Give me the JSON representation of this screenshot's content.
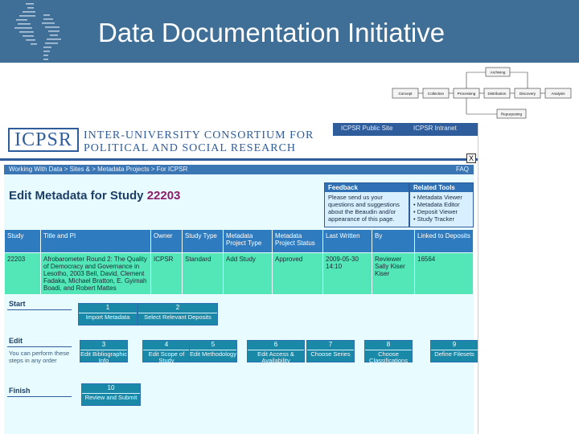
{
  "slide": {
    "title": "Data Documentation Initiative"
  },
  "lifecycle": {
    "stages": [
      "Concept",
      "Collection",
      "Processing",
      "Distribution",
      "Discovery",
      "Analysis"
    ],
    "archiving": "Archiving",
    "repurposing": "Repurposing"
  },
  "icpsr": {
    "logo": "ICPSR",
    "name_line1": "INTER-UNIVERSITY CONSORTIUM FOR",
    "name_line2": "POLITICAL AND SOCIAL RESEARCH",
    "toplinks": [
      "ICPSR Public Site",
      "ICPSR Intranet"
    ],
    "close_label": "X",
    "breadcrumb": "Working With Data > Sites & > Metadata Projects > For ICPSR",
    "breadcrumb_right": "FAQ",
    "heading_prefix": "Edit Metadata for Study",
    "study_number": "22203",
    "feedback": {
      "title": "Feedback",
      "text": "Please send us your questions and suggestions about the Beaudin and/or appearance of this page."
    },
    "related": {
      "title": "Related Tools",
      "items": [
        "• Metadata Viewer",
        "• Metadata Editor",
        "• Deposit Viewer",
        "• Study Tracker"
      ]
    },
    "table": {
      "headers": [
        "Study",
        "Title and PI",
        "Owner",
        "Study Type",
        "Metadata Project Type",
        "Metadata Project Status",
        "Last Written",
        "By",
        "Linked to Deposits"
      ],
      "row": [
        "22203",
        "Afrobarometer Round 2: The Quality of Democracy and Governance in Lesotho, 2003 Bell, David, Clement Fadaka, Michael Bratton, E. Gyimah Boadi, and Robert Mattes",
        "ICPSR",
        "Standard",
        "Add Study",
        "Approved",
        "2009-05-30 14:10",
        "Reviewer Sally Kiser Kiser",
        "16564"
      ]
    },
    "sections": {
      "start": "Start",
      "edit": "Edit",
      "edit_note": "You can perform these steps in any order",
      "finish": "Finish"
    },
    "steps_start": [
      {
        "n": "1",
        "label": "Import Metadata"
      },
      {
        "n": "2",
        "label": "Select Relevant Deposits"
      }
    ],
    "steps_edit": [
      {
        "n": "3",
        "label": "Edit Bibliographic Info"
      },
      {
        "n": "4",
        "label": "Edit Scope of Study"
      },
      {
        "n": "5",
        "label": "Edit Methodology"
      },
      {
        "n": "6",
        "label": "Edit Access & Availability"
      },
      {
        "n": "7",
        "label": "Choose Series"
      },
      {
        "n": "8",
        "label": "Choose Classifications"
      },
      {
        "n": "9",
        "label": "Define Filesets"
      }
    ],
    "steps_finish": [
      {
        "n": "10",
        "label": "Review and Submit"
      }
    ]
  },
  "colors": {
    "slide_band": "#3f6f96",
    "icpsr_blue": "#2f5c9a",
    "row_green": "#53e6b7",
    "step_teal": "#1a89a8"
  }
}
